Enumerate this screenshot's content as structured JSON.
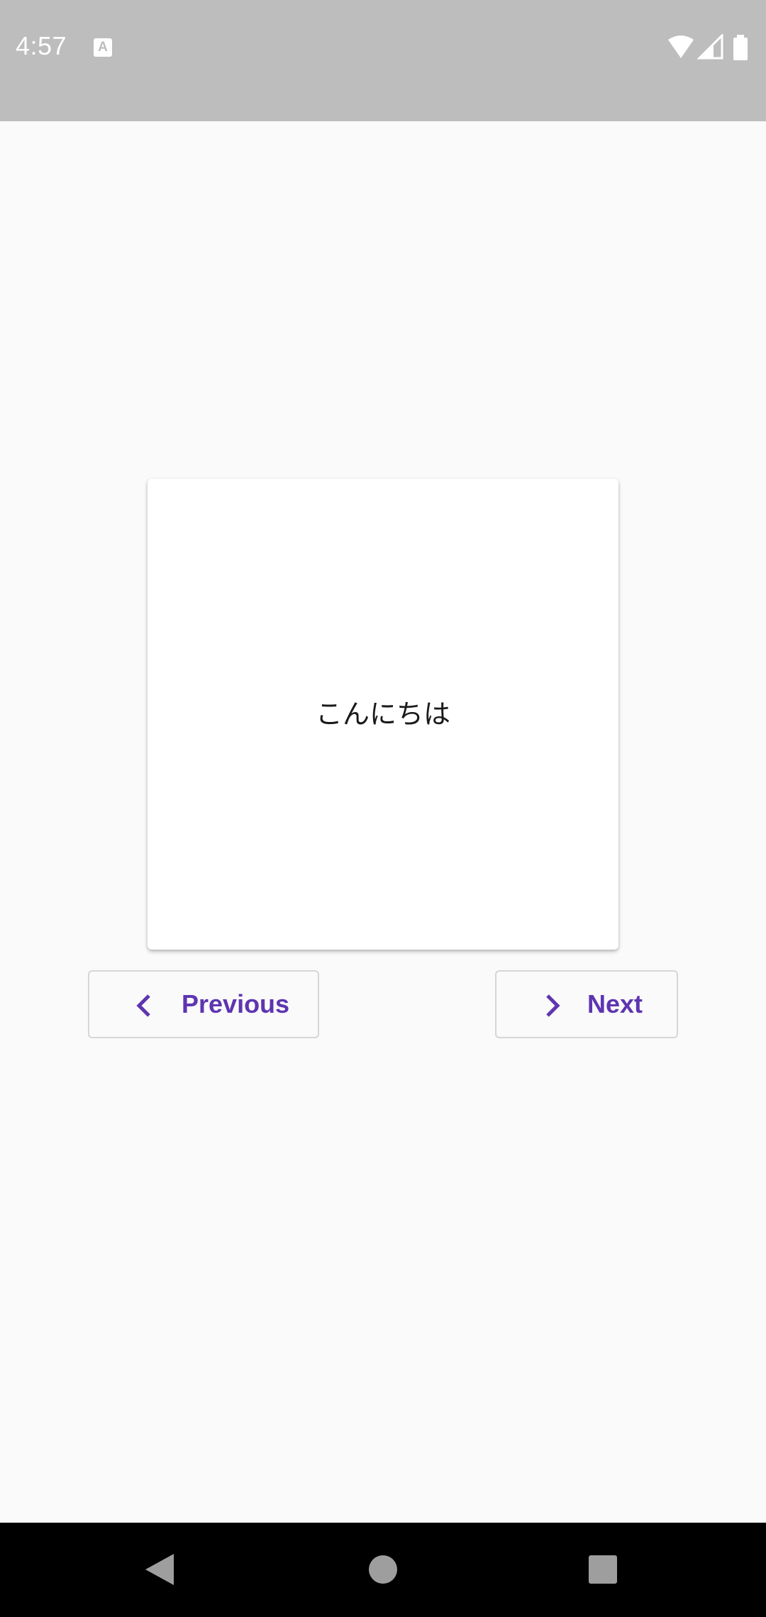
{
  "status_bar": {
    "time": "4:57",
    "app_icon": "keyboard-a-icon",
    "icons": [
      "wifi-icon",
      "signal-icon",
      "battery-icon"
    ],
    "background": "#bdbdbd"
  },
  "flashcard": {
    "text": "こんにちは"
  },
  "navigation": {
    "previous_label": "Previous",
    "previous_icon": "chevron-left-icon",
    "next_label": "Next",
    "next_icon": "chevron-right-icon",
    "accent_color": "#5e35b1"
  },
  "system_nav": {
    "buttons": [
      "back-icon",
      "home-icon",
      "recents-icon"
    ]
  }
}
